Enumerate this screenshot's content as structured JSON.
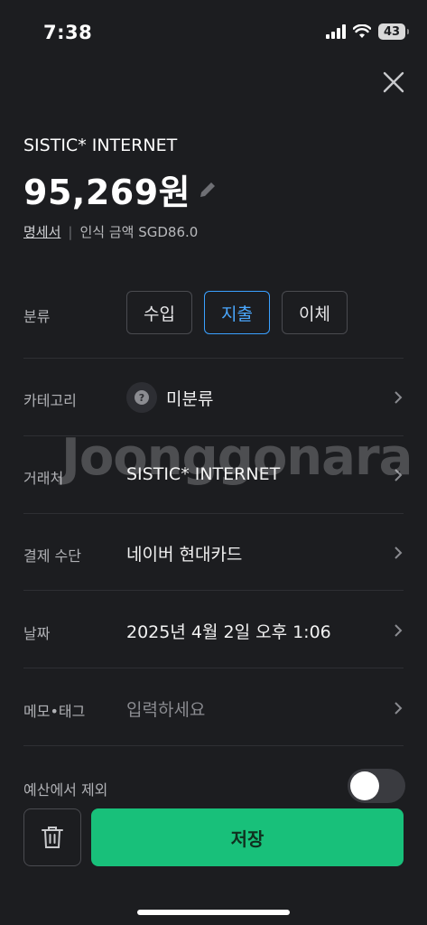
{
  "status_bar": {
    "time": "7:38",
    "battery": "43"
  },
  "transaction": {
    "merchant": "SISTIC* INTERNET",
    "amount": "95,269원",
    "statement_link": "명세서",
    "separator": "|",
    "recognized_amount": "인식 금액 SGD86.0"
  },
  "type_row": {
    "label": "분류",
    "options": [
      "수입",
      "지출",
      "이체"
    ],
    "selected": "지출"
  },
  "rows": {
    "category": {
      "label": "카테고리",
      "value": "미분류",
      "icon": "question-icon"
    },
    "merchant": {
      "label": "거래처",
      "value": "SISTIC* INTERNET"
    },
    "payment": {
      "label": "결제 수단",
      "value": "네이버 현대카드"
    },
    "date": {
      "label": "날짜",
      "value": "2025년 4월 2일 오후 1:06"
    },
    "memo": {
      "label": "메모•태그",
      "placeholder": "입력하세요"
    }
  },
  "budget_exclude": {
    "label": "예산에서 제외",
    "on": false
  },
  "actions": {
    "save_label": "저장",
    "delete_icon": "trash-icon"
  },
  "watermark": "Joonggonara",
  "colors": {
    "accent": "#3aa0ff",
    "save": "#18c07a",
    "background": "#1c1d20"
  }
}
